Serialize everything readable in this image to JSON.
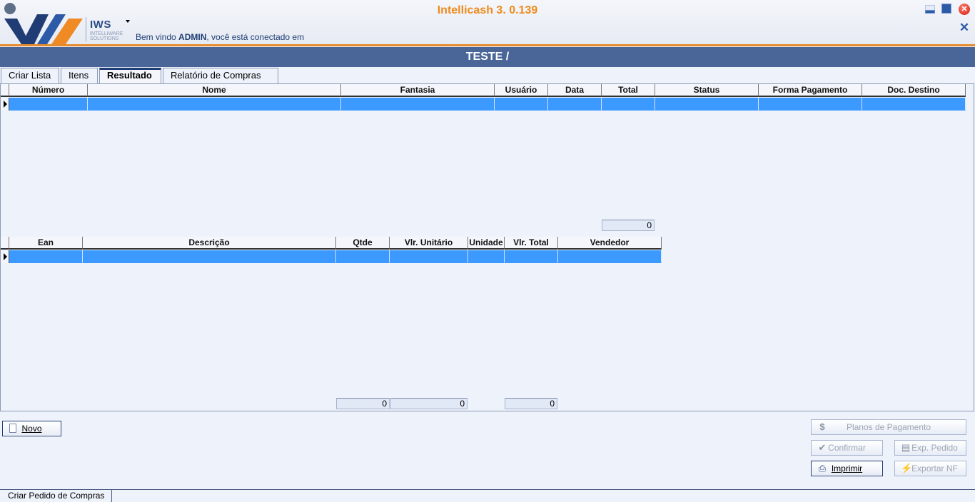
{
  "app": {
    "title": "Intellicash 3. 0.139",
    "logo_text": "IWS",
    "logo_sub": "INTELLIWARE SOLUTIONS",
    "welcome_prefix": "Bem vindo ",
    "welcome_user": "ADMIN",
    "welcome_suffix": ", você está conectado em"
  },
  "page": {
    "title": "TESTE /"
  },
  "tabs": [
    {
      "label": "Criar Lista",
      "active": false
    },
    {
      "label": "Itens",
      "active": false
    },
    {
      "label": "Resultado",
      "active": true
    },
    {
      "label": "Relatório de Compras",
      "active": false
    }
  ],
  "grid_top": {
    "columns": [
      "Número",
      "Nome",
      "Fantasia",
      "Usuário",
      "Data",
      "Total",
      "Status",
      "Forma Pagamento",
      "Doc. Destino"
    ],
    "total": "0"
  },
  "grid_bottom": {
    "columns": [
      "Ean",
      "Descrição",
      "Qtde",
      "Vlr. Unitário",
      "Unidade",
      "Vlr. Total",
      "Vendedor"
    ],
    "totals": {
      "qtde": "0",
      "vlr_unitario": "0",
      "vlr_total": "0"
    }
  },
  "buttons": {
    "novo": "Novo",
    "planos": "Planos de Pagamento",
    "confirmar": "Confirmar",
    "exp_pedido": "Exp. Pedido",
    "imprimir": "Imprimir",
    "exportar_nf": "Exportar NF"
  },
  "status": {
    "form_tab": "Criar Pedido de Compras"
  },
  "colors": {
    "accent": "#ef8a1c",
    "title_bar": "#4a6699",
    "selected_row": "#3b99ff"
  }
}
